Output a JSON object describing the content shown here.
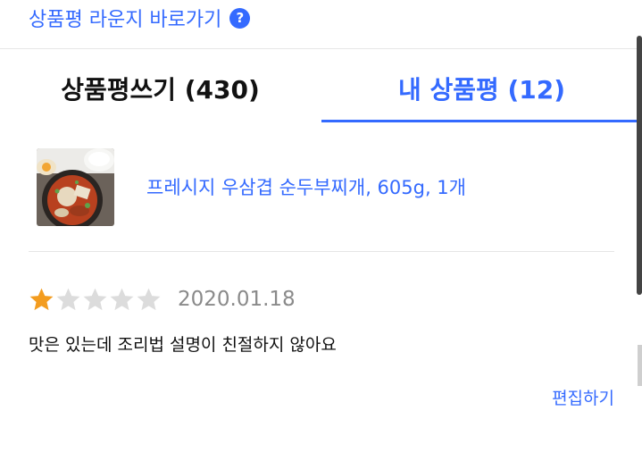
{
  "lounge": {
    "label": "상품평 라운지 바로가기",
    "help_glyph": "?"
  },
  "tabs": [
    {
      "label": "상품평쓰기 (430)",
      "active": false
    },
    {
      "label": "내 상품평 (12)",
      "active": true
    }
  ],
  "product": {
    "name": "프레시지 우삼겹 순두부찌개, 605g, 1개"
  },
  "review": {
    "rating": 1,
    "max_rating": 5,
    "date": "2020.01.18",
    "text": "맛은 있는데 조리법 설명이 친절하지 않아요",
    "edit_label": "편집하기"
  },
  "colors": {
    "accent": "#346aff",
    "star_filled": "#f39c1f",
    "star_empty": "#dcdcdc",
    "text": "#111111",
    "muted": "#8a8a8a",
    "divider": "#e6e6e6"
  }
}
